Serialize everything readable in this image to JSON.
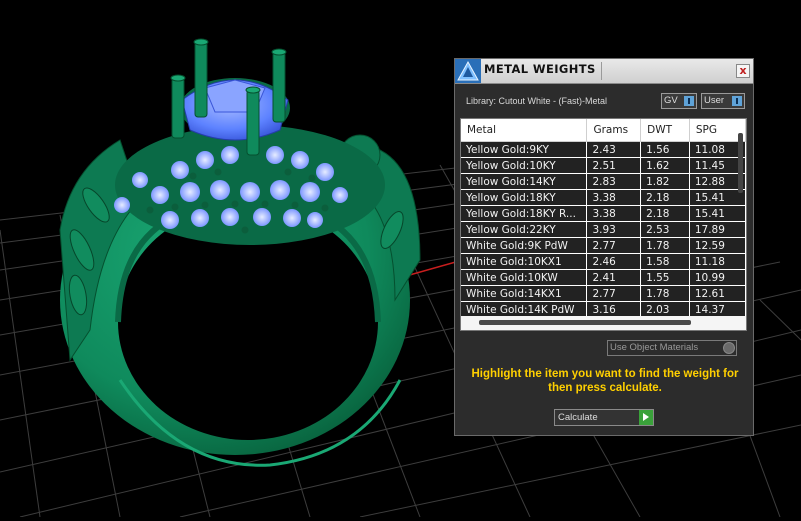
{
  "panel": {
    "title": "METAL WEIGHTS",
    "close_label": "x",
    "library_label": "Library: Cutout White - (Fast)-Metal",
    "gv_label": "GV",
    "user_label": "User",
    "columns": [
      "Metal",
      "Grams",
      "DWT",
      "SPG"
    ],
    "rows": [
      [
        "Yellow Gold:9KY",
        "2.43",
        "1.56",
        "11.08"
      ],
      [
        "Yellow Gold:10KY",
        "2.51",
        "1.62",
        "11.45"
      ],
      [
        "Yellow Gold:14KY",
        "2.83",
        "1.82",
        "12.88"
      ],
      [
        "Yellow Gold:18KY",
        "3.38",
        "2.18",
        "15.41"
      ],
      [
        "Yellow Gold:18KY R...",
        "3.38",
        "2.18",
        "15.41"
      ],
      [
        "Yellow Gold:22KY",
        "3.93",
        "2.53",
        "17.89"
      ],
      [
        "White Gold:9K PdW",
        "2.77",
        "1.78",
        "12.59"
      ],
      [
        "White Gold:10KX1",
        "2.46",
        "1.58",
        "11.18"
      ],
      [
        "White Gold:10KW",
        "2.41",
        "1.55",
        "10.99"
      ],
      [
        "White Gold:14KX1",
        "2.77",
        "1.78",
        "12.61"
      ],
      [
        "White Gold:14K PdW",
        "3.16",
        "2.03",
        "14.37"
      ]
    ],
    "materials_label": "Use Object Materials",
    "message": "Highlight the item you want to find the weight for then press calculate.",
    "calculate_label": "Calculate"
  },
  "colors": {
    "ring_green": "#0f8a5c",
    "gem_blue": "#5d82ff",
    "axis_red": "#c81e1e",
    "message_yellow": "#ffd000"
  },
  "icons": [
    "triangle-logo-icon",
    "close-icon",
    "toggle-icon",
    "gear-icon",
    "play-icon"
  ]
}
